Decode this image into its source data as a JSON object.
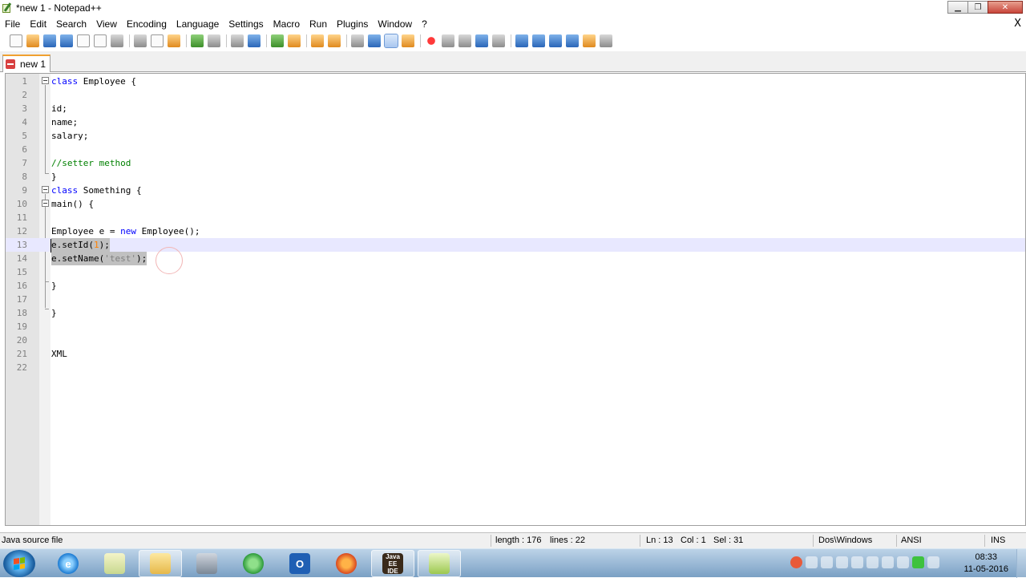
{
  "window": {
    "title": "*new  1 - Notepad++",
    "minimize_label": "▁",
    "maximize_label": "❐",
    "close_label": "✕"
  },
  "menu": {
    "items": [
      "File",
      "Edit",
      "Search",
      "View",
      "Encoding",
      "Language",
      "Settings",
      "Macro",
      "Run",
      "Plugins",
      "Window",
      "?"
    ],
    "close_doc": "X"
  },
  "toolbar": {
    "icons": [
      "new-file-icon",
      "open-file-icon",
      "save-icon",
      "save-all-icon",
      "close-icon",
      "close-all-icon",
      "print-icon",
      "cut-icon",
      "copy-icon",
      "paste-icon",
      "undo-icon",
      "redo-icon",
      "find-icon",
      "replace-icon",
      "zoom-in-icon",
      "zoom-out-icon",
      "sync-vertical-icon",
      "sync-horizontal-icon",
      "word-wrap-icon",
      "show-all-chars-icon",
      "indent-guide-icon",
      "function-list-icon",
      "record-macro-icon",
      "stop-macro-icon",
      "play-macro-icon",
      "run-macro-multiple-icon",
      "save-macro-icon",
      "trim-icon",
      "move-up-icon",
      "move-down-icon",
      "collapse-icon",
      "launch-browser-icon",
      "spell-check-icon"
    ]
  },
  "tab": {
    "label": "new 1"
  },
  "editor": {
    "lines": [
      {
        "n": "1",
        "text": "class Employee {"
      },
      {
        "n": "2",
        "text": ""
      },
      {
        "n": "3",
        "text": "id;"
      },
      {
        "n": "4",
        "text": "name;"
      },
      {
        "n": "5",
        "text": "salary;"
      },
      {
        "n": "6",
        "text": ""
      },
      {
        "n": "7",
        "text": "//setter method"
      },
      {
        "n": "8",
        "text": "}"
      },
      {
        "n": "9",
        "text": "class Something {"
      },
      {
        "n": "10",
        "text": "main() {"
      },
      {
        "n": "11",
        "text": ""
      },
      {
        "n": "12",
        "text": "Employee e = new Employee();"
      },
      {
        "n": "13",
        "text": "e.setId(1);"
      },
      {
        "n": "14",
        "text": "e.setName('test');"
      },
      {
        "n": "15",
        "text": ""
      },
      {
        "n": "16",
        "text": "}"
      },
      {
        "n": "17",
        "text": ""
      },
      {
        "n": "18",
        "text": "}"
      },
      {
        "n": "19",
        "text": ""
      },
      {
        "n": "20",
        "text": ""
      },
      {
        "n": "21",
        "text": "XML"
      },
      {
        "n": "22",
        "text": ""
      }
    ]
  },
  "status": {
    "file_type": "Java source file",
    "length": "length : 176",
    "lines": "lines : 22",
    "ln": "Ln : 13",
    "col": "Col : 1",
    "sel": "Sel : 31",
    "eol": "Dos\\Windows",
    "encoding": "ANSI",
    "mode": "INS"
  },
  "taskbar": {
    "apps": [
      "Internet Explorer",
      "Notepad",
      "Windows Explorer",
      "Computer",
      "Browser",
      "Outlook",
      "Firefox",
      "Java EE IDE",
      "Notepad++"
    ],
    "outlook_letter": "O",
    "ide_label": "Java EE IDE",
    "time": "08:33",
    "date": "11-05-2016"
  },
  "colors": {
    "keyword": "#0000ff",
    "comment": "#008000",
    "number": "#ff8000",
    "string": "#808080",
    "selection": "#c0c0c0",
    "tab_accent": "#f0a030"
  }
}
